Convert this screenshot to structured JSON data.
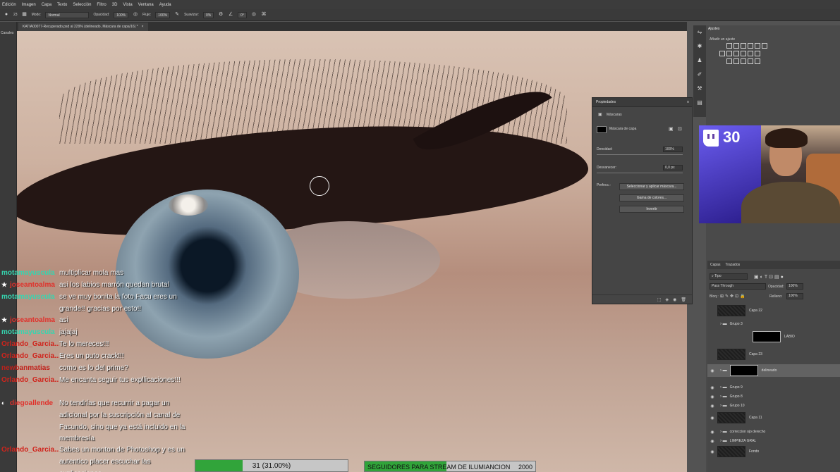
{
  "menu": [
    "Edición",
    "Imagen",
    "Capa",
    "Texto",
    "Selección",
    "Filtro",
    "3D",
    "Vista",
    "Ventana",
    "Ayuda"
  ],
  "options": {
    "mode_label": "Modo:",
    "mode_value": "Normal",
    "opacity_label": "Opacidad:",
    "opacity_value": "100%",
    "flow_label": "Flujo:",
    "flow_value": "100%",
    "smooth_label": "Suavizar:",
    "smooth_value": "0%",
    "angle_value": "0°",
    "brush_size": "23"
  },
  "document": {
    "tab_title": "KATIA00077-Recuperado.psd al 229% (delineado, Máscara de capa/16) *",
    "close_glyph": "×"
  },
  "left_panel": {
    "label": "Canales"
  },
  "properties": {
    "title": "Propiedades",
    "section": "Máscaras",
    "mask_label": "Máscara de capa",
    "density_label": "Densidad:",
    "density_value": "100%",
    "feather_label": "Desvanecer:",
    "feather_value": "0,0 px",
    "refine_label": "Perfecc.:",
    "btn_select_mask": "Seleccionar y aplicar máscara...",
    "btn_color_range": "Gama de colores...",
    "btn_invert": "Invertir"
  },
  "adjustments": {
    "title": "Ajustes",
    "subtitle": "Añadir un ajuste"
  },
  "webcam": {
    "overlay_number": "30"
  },
  "layers": {
    "tab_layers": "Capas",
    "tab_paths": "Trazados",
    "filter_kind": "Tipo",
    "blend_mode": "Pass Through",
    "opacity_label": "Opacidad:",
    "opacity_value": "100%",
    "lock_label": "Bloq.:",
    "fill_label": "Relleno:",
    "fill_value": "100%",
    "rows": [
      {
        "name": "Capa 22",
        "kind": "layer",
        "visible": false
      },
      {
        "name": "Grupo 3",
        "kind": "group",
        "visible": false
      },
      {
        "name": "LABIO",
        "kind": "mask",
        "visible": false
      },
      {
        "name": "Capa 23",
        "kind": "layer",
        "visible": false
      },
      {
        "name": "delineado",
        "kind": "group-mask",
        "visible": true,
        "selected": true
      },
      {
        "name": "Grupo 9",
        "kind": "group",
        "visible": true
      },
      {
        "name": "Grupo 8",
        "kind": "group",
        "visible": true
      },
      {
        "name": "Grupo 10",
        "kind": "group",
        "visible": true
      },
      {
        "name": "Capa 11",
        "kind": "layer",
        "visible": true
      },
      {
        "name": "correccion ojo derecho",
        "kind": "group",
        "visible": true
      },
      {
        "name": "LIMPIEZA GRAL",
        "kind": "group",
        "visible": true
      },
      {
        "name": "Fondo",
        "kind": "layer",
        "visible": true
      }
    ]
  },
  "chat": [
    {
      "user": "motamayuscula",
      "color": "#35d6b0",
      "badge": "",
      "text": "multiplicar mola mas"
    },
    {
      "user": "joseantoalma",
      "color": "#e0302a",
      "badge": "★",
      "text": "asi los labios marrón quedan brutal"
    },
    {
      "user": "motamayuscula",
      "color": "#35d6b0",
      "badge": "",
      "text": "se ve muy bonita la foto Facu eres un grande!! gracias por esto!!"
    },
    {
      "user": "joseantoalma",
      "color": "#e0302a",
      "badge": "★",
      "text": "asi"
    },
    {
      "user": "motamayuscula",
      "color": "#35d6b0",
      "badge": "",
      "text": "jajajaj"
    },
    {
      "user": "Orlando_Garcia...",
      "color": "#d0241c",
      "badge": "",
      "text": "Te lo mereces!!!"
    },
    {
      "user": "Orlando_Garcia...",
      "color": "#d0241c",
      "badge": "",
      "text": "Eres un puto crack!!!"
    },
    {
      "user": "newbanmatias",
      "color": "#c0201a",
      "badge": "",
      "text": "como es lo del prime?"
    },
    {
      "user": "Orlando_Garcia...",
      "color": "#d0241c",
      "badge": "",
      "text": "Me encanta seguir tus expllicaciones!!!"
    },
    {
      "user": "diegoallende",
      "color": "#e0302a",
      "badge": "◐",
      "text": "No tendrías que recurrir a pagar un adicional por la suscripción al canal de Facundo, sino que ya está incluido en la membresía"
    },
    {
      "user": "Orlando_Garcia...",
      "color": "#d0241c",
      "badge": "",
      "text": "Sabes un monton de Photoshop y es un autentico placer escuchar las explicaciones"
    }
  ],
  "goal_bar": {
    "text": "31 (31.00%)",
    "progress": 0.31
  },
  "follow_bar": {
    "label": "SEGUIDORES PARA STREAM DE ILUMIANCION",
    "goal": "2000",
    "progress": 0.48
  }
}
